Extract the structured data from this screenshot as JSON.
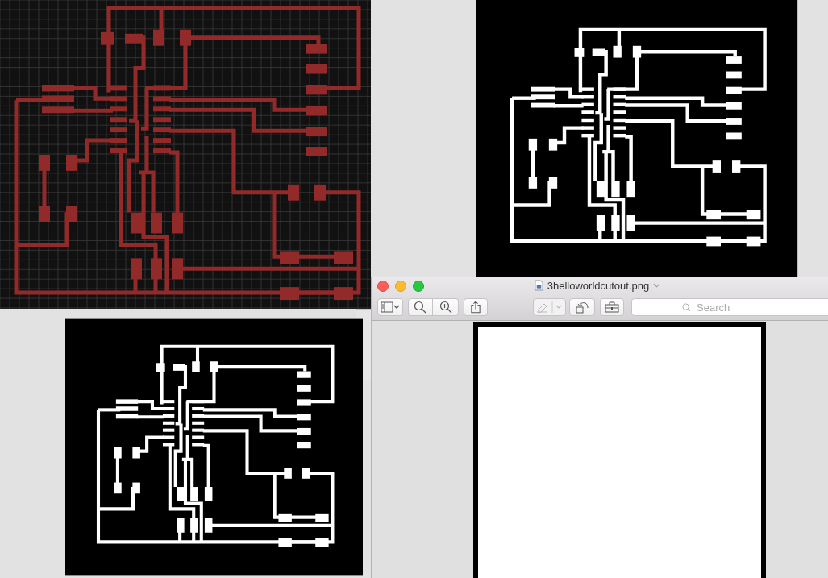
{
  "desktop_images": [
    {
      "kind": "copper"
    },
    {
      "kind": "mask"
    },
    {
      "kind": "mask"
    }
  ],
  "preview_window": {
    "title": "3helloworldcutout.png",
    "toolbar": [
      {
        "kind": "sidebar",
        "disabled": false
      },
      {
        "kind": "zoomout",
        "disabled": false
      },
      {
        "kind": "zoomin",
        "disabled": false
      },
      {
        "kind": "share",
        "disabled": false
      },
      {
        "kind": "markup",
        "disabled": true
      },
      {
        "kind": "rotate",
        "disabled": false
      },
      {
        "kind": "toolbox",
        "disabled": false
      }
    ],
    "search": {
      "placeholder": "Search"
    }
  }
}
